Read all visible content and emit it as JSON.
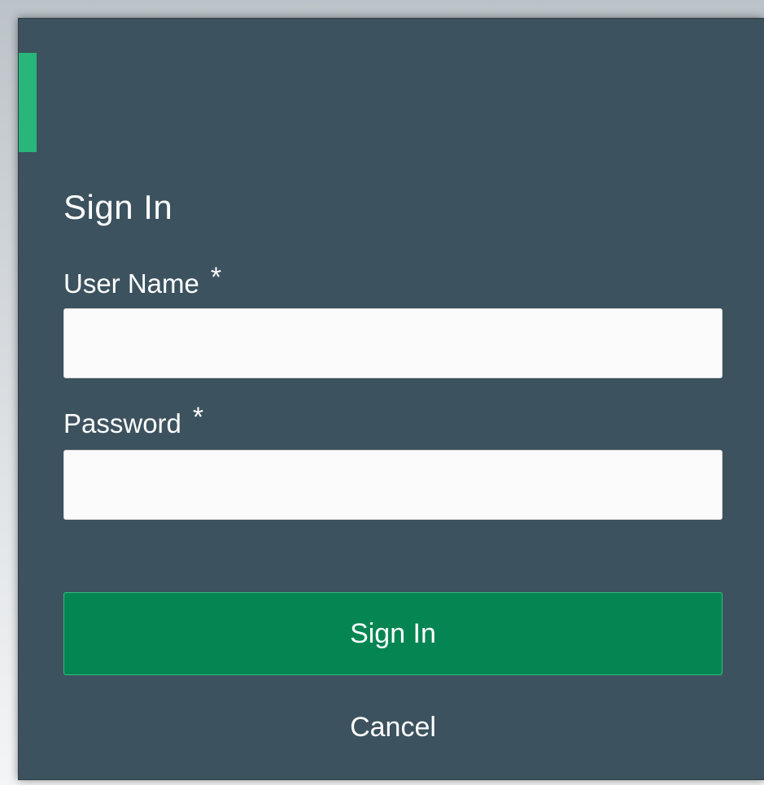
{
  "dialog": {
    "title": "Sign In",
    "accent_color": "#28b67a",
    "background_color": "#3c525e"
  },
  "fields": {
    "username": {
      "label": "User Name",
      "required_marker": "*",
      "value": "",
      "placeholder": ""
    },
    "password": {
      "label": "Password",
      "required_marker": "*",
      "value": "",
      "placeholder": ""
    }
  },
  "actions": {
    "signin_label": "Sign In",
    "signin_color": "#048552",
    "cancel_label": "Cancel"
  }
}
